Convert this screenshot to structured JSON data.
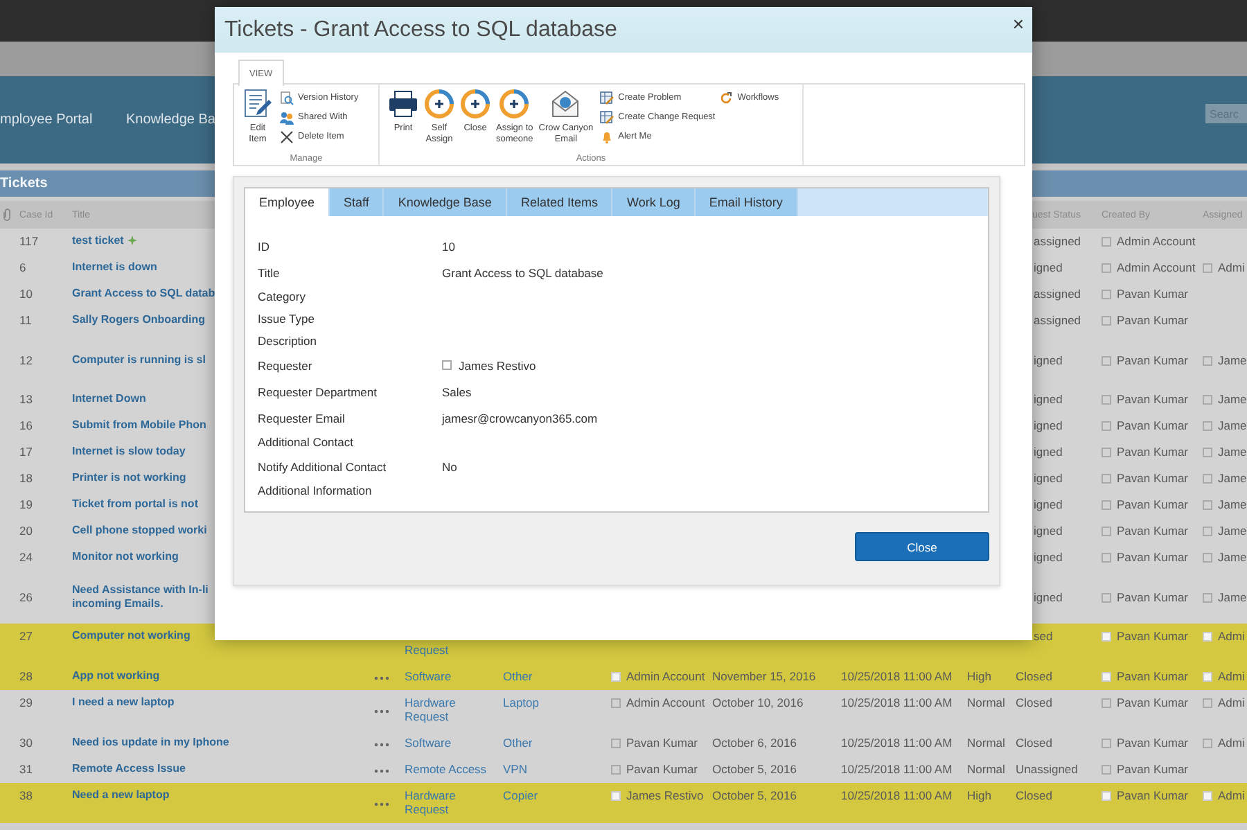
{
  "site_nav": {
    "items": [
      {
        "label": "mployee Portal"
      },
      {
        "label": "Knowledge Ba"
      }
    ],
    "search": {
      "placeholder": "Searc"
    }
  },
  "list": {
    "title": "Tickets",
    "columns": [
      {
        "label": "Case Id"
      },
      {
        "label": "Title"
      },
      {
        "label": "uest Status"
      },
      {
        "label": "Created By"
      },
      {
        "label": "Assigned"
      }
    ],
    "rows": [
      {
        "kind": "covered",
        "case_id": "117",
        "title": "test ticket",
        "is_new": true,
        "highlighted": false,
        "tall": false,
        "status": "assigned",
        "created_by": "Admin Account"
      },
      {
        "kind": "covered",
        "case_id": "6",
        "title": "Internet is down",
        "is_new": false,
        "highlighted": false,
        "tall": false,
        "status": "igned",
        "created_by": "Admin Account",
        "assigned_to": "Admi"
      },
      {
        "kind": "covered",
        "case_id": "10",
        "title": "Grant Access to SQL datab",
        "is_new": false,
        "highlighted": false,
        "tall": false,
        "status": "assigned",
        "created_by": "Pavan Kumar"
      },
      {
        "kind": "covered",
        "case_id": "11",
        "title": "Sally Rogers Onboarding",
        "is_new": false,
        "highlighted": false,
        "tall": false,
        "status": "assigned",
        "created_by": "Pavan Kumar"
      },
      {
        "kind": "covered",
        "case_id": "12",
        "title": "Computer is running is sl",
        "is_new": false,
        "highlighted": false,
        "tall": true,
        "status": "igned",
        "created_by": "Pavan Kumar",
        "assigned_to": "Jame"
      },
      {
        "kind": "covered",
        "case_id": "13",
        "title": "Internet Down",
        "is_new": false,
        "highlighted": false,
        "tall": false,
        "status": "igned",
        "created_by": "Pavan Kumar",
        "assigned_to": "Jame"
      },
      {
        "kind": "covered",
        "case_id": "16",
        "title": "Submit from Mobile Phon",
        "is_new": false,
        "highlighted": false,
        "tall": false,
        "status": "igned",
        "created_by": "Pavan Kumar",
        "assigned_to": "Jame"
      },
      {
        "kind": "covered",
        "case_id": "17",
        "title": "Internet is slow today",
        "is_new": false,
        "highlighted": false,
        "tall": false,
        "status": "igned",
        "created_by": "Pavan Kumar",
        "assigned_to": "Jame"
      },
      {
        "kind": "covered",
        "case_id": "18",
        "title": "Printer is not working",
        "is_new": false,
        "highlighted": false,
        "tall": false,
        "status": "igned",
        "created_by": "Pavan Kumar",
        "assigned_to": "Jame"
      },
      {
        "kind": "covered",
        "case_id": "19",
        "title": "Ticket from portal is not",
        "is_new": false,
        "highlighted": false,
        "tall": false,
        "status": "igned",
        "created_by": "Pavan Kumar",
        "assigned_to": "Jame"
      },
      {
        "kind": "covered",
        "case_id": "20",
        "title": "Cell phone stopped worki",
        "is_new": false,
        "highlighted": false,
        "tall": false,
        "status": "igned",
        "created_by": "Pavan Kumar",
        "assigned_to": "Jame"
      },
      {
        "kind": "covered",
        "case_id": "24",
        "title": "Monitor not working",
        "is_new": false,
        "highlighted": false,
        "tall": false,
        "status": "igned",
        "created_by": "Pavan Kumar",
        "assigned_to": "Jame"
      },
      {
        "kind": "covered",
        "case_id": "26",
        "title": "Need Assistance with In-li\nincoming Emails.",
        "is_new": false,
        "highlighted": false,
        "tall": true,
        "status": "igned",
        "created_by": "Pavan Kumar",
        "assigned_to": "Jame"
      },
      {
        "kind": "covered",
        "case_id": "27",
        "title": "Computer not working",
        "is_new": false,
        "highlighted": true,
        "tall": false,
        "category": "Request",
        "status": "sed",
        "created_by": "Pavan Kumar",
        "assigned_to": "Admi"
      },
      {
        "kind": "full",
        "case_id": "28",
        "title": "App not working",
        "is_new": false,
        "highlighted": true,
        "tall": false,
        "category": "Software",
        "subcategory": "Other",
        "requester": "Admin Account",
        "date": "November 15, 2016",
        "due": "10/25/2018 11:00 AM",
        "priority": "High",
        "status": "Closed",
        "created_by": "Pavan Kumar",
        "assigned_to": "Admi"
      },
      {
        "kind": "full",
        "case_id": "29",
        "title": "I need a new laptop",
        "is_new": false,
        "highlighted": false,
        "tall": false,
        "category": "Hardware Request",
        "subcategory": "Laptop",
        "requester": "Admin Account",
        "date": "October 10, 2016",
        "due": "10/25/2018 11:00 AM",
        "priority": "Normal",
        "status": "Closed",
        "created_by": "Pavan Kumar",
        "assigned_to": "Admi"
      },
      {
        "kind": "full",
        "case_id": "30",
        "title": "Need ios update in my Iphone",
        "is_new": false,
        "highlighted": false,
        "tall": false,
        "category": "Software",
        "subcategory": "Other",
        "requester": "Pavan Kumar",
        "date": "October 6, 2016",
        "due": "10/25/2018 11:00 AM",
        "priority": "Normal",
        "status": "Closed",
        "created_by": "Pavan Kumar",
        "assigned_to": "Admi"
      },
      {
        "kind": "full",
        "case_id": "31",
        "title": "Remote Access Issue",
        "is_new": false,
        "highlighted": false,
        "tall": false,
        "category": "Remote Access",
        "subcategory": "VPN",
        "requester": "Pavan Kumar",
        "date": "October 5, 2016",
        "due": "10/25/2018 11:00 AM",
        "priority": "Normal",
        "status": "Unassigned",
        "created_by": "Pavan Kumar"
      },
      {
        "kind": "full",
        "case_id": "38",
        "title": "Need a new laptop",
        "is_new": false,
        "highlighted": true,
        "tall": false,
        "category": "Hardware Request",
        "subcategory": "Copier",
        "requester": "James Restivo",
        "date": "October 5, 2016",
        "due": "10/25/2018 11:00 AM",
        "priority": "High",
        "status": "Closed",
        "created_by": "Pavan Kumar",
        "assigned_to": "Admi"
      }
    ]
  },
  "dialog": {
    "title": "Tickets - Grant Access to SQL database",
    "close": "×",
    "ribbon": {
      "tabs": [
        {
          "label": "VIEW",
          "selected": true
        }
      ],
      "groups": [
        {
          "label": "Manage",
          "large": [
            {
              "kind": "edit",
              "label": "Edit\nItem"
            }
          ],
          "small": [
            [
              {
                "kind": "history",
                "label": "Version History"
              },
              {
                "kind": "share",
                "label": "Shared With"
              },
              {
                "kind": "delete",
                "label": "Delete Item"
              }
            ]
          ]
        },
        {
          "label": "Actions",
          "large": [
            {
              "kind": "print",
              "label": "Print"
            },
            {
              "kind": "assign",
              "label": "Self\nAssign"
            },
            {
              "kind": "assign",
              "label": "Close"
            },
            {
              "kind": "assign",
              "label": "Assign to\nsomeone"
            },
            {
              "kind": "email",
              "label": "Crow Canyon\nEmail"
            }
          ],
          "small": [
            [
              {
                "kind": "form",
                "label": "Create Problem"
              },
              {
                "kind": "form",
                "label": "Create Change Request"
              },
              {
                "kind": "bell",
                "label": "Alert Me"
              }
            ],
            [
              {
                "kind": "workflow",
                "label": "Workflows"
              }
            ]
          ]
        }
      ]
    },
    "form": {
      "tabs": [
        {
          "label": "Employee",
          "selected": true
        },
        {
          "label": "Staff",
          "selected": false
        },
        {
          "label": "Knowledge Base",
          "selected": false
        },
        {
          "label": "Related Items",
          "selected": false
        },
        {
          "label": "Work Log",
          "selected": false
        },
        {
          "label": "Email History",
          "selected": false
        }
      ],
      "fields": [
        {
          "kind": "text",
          "label": "ID",
          "value": "10"
        },
        {
          "kind": "text",
          "label": "Title",
          "value": "Grant Access to SQL database"
        },
        {
          "kind": "text",
          "label": "Category"
        },
        {
          "kind": "text",
          "label": "Issue Type"
        },
        {
          "kind": "text",
          "label": "Description"
        },
        {
          "kind": "person",
          "label": "Requester",
          "value": "James Restivo"
        },
        {
          "kind": "text",
          "label": "Requester Department",
          "value": "Sales"
        },
        {
          "kind": "text",
          "label": "Requester Email",
          "value": "jamesr@crowcanyon365.com"
        },
        {
          "kind": "text",
          "label": "Additional Contact"
        },
        {
          "kind": "text",
          "label": "Notify Additional Contact",
          "value": "No"
        },
        {
          "kind": "text",
          "label": "Additional Information"
        }
      ]
    },
    "buttons": [
      {
        "label": "Close"
      }
    ]
  }
}
